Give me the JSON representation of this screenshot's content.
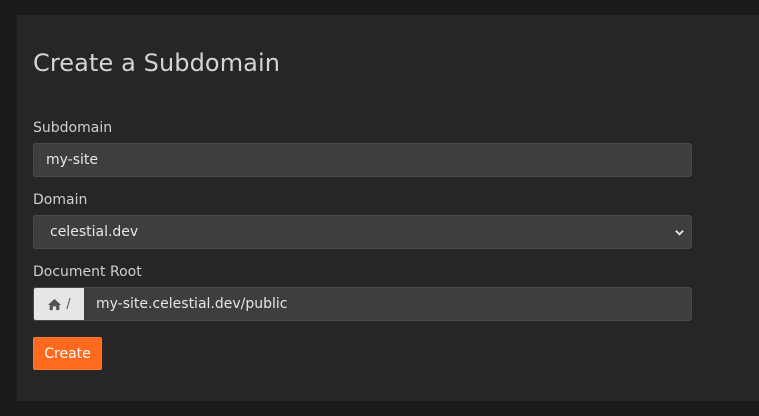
{
  "form": {
    "title": "Create a Subdomain",
    "subdomain": {
      "label": "Subdomain",
      "value": "my-site"
    },
    "domain": {
      "label": "Domain",
      "selected": "celestial.dev"
    },
    "document_root": {
      "label": "Document Root",
      "prefix": "/",
      "value": "my-site.celestial.dev/public"
    },
    "create_label": "Create"
  },
  "icons": {
    "home": "home-icon",
    "chevron": "chevron-down-icon"
  },
  "colors": {
    "accent": "#ff6a1f",
    "panel": "#262626",
    "input": "#3e3e3e"
  }
}
